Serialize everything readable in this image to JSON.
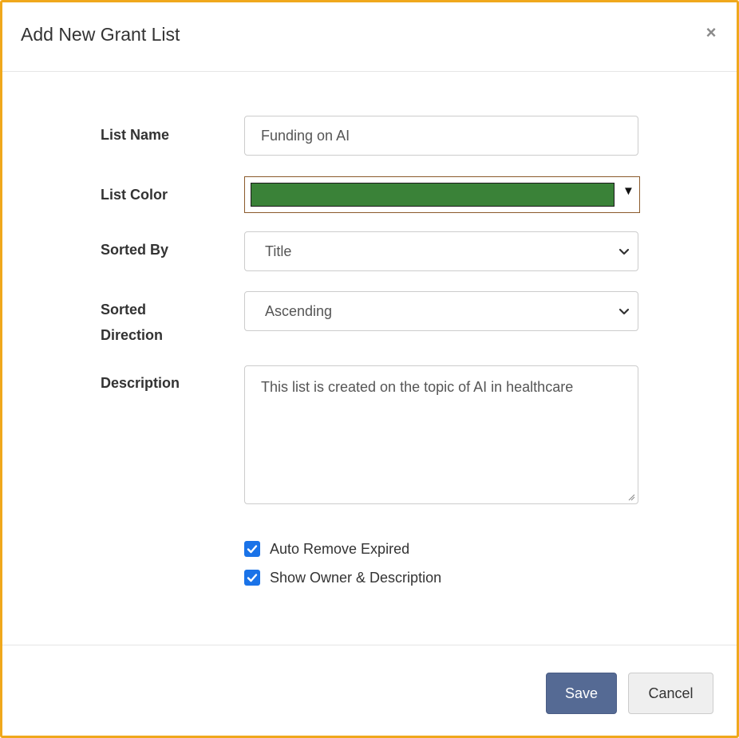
{
  "modal": {
    "title": "Add New Grant List",
    "close_symbol": "×"
  },
  "form": {
    "list_name": {
      "label": "List Name",
      "value": "Funding on AI"
    },
    "list_color": {
      "label": "List Color",
      "value_color": "#3a8238"
    },
    "sorted_by": {
      "label": "Sorted By",
      "value": "Title"
    },
    "sorted_direction": {
      "label_line1": "Sorted",
      "label_line2": "Direction",
      "value": "Ascending"
    },
    "description": {
      "label": "Description",
      "value": "This list is created on the topic of AI in healthcare"
    },
    "checkboxes": [
      {
        "label": "Auto Remove Expired",
        "checked": true
      },
      {
        "label": "Show Owner & Description",
        "checked": true
      }
    ]
  },
  "footer": {
    "save_label": "Save",
    "cancel_label": "Cancel"
  },
  "colors": {
    "modal_border": "#f0a81c",
    "save_button": "#556a94",
    "checkbox": "#1a73e8"
  }
}
